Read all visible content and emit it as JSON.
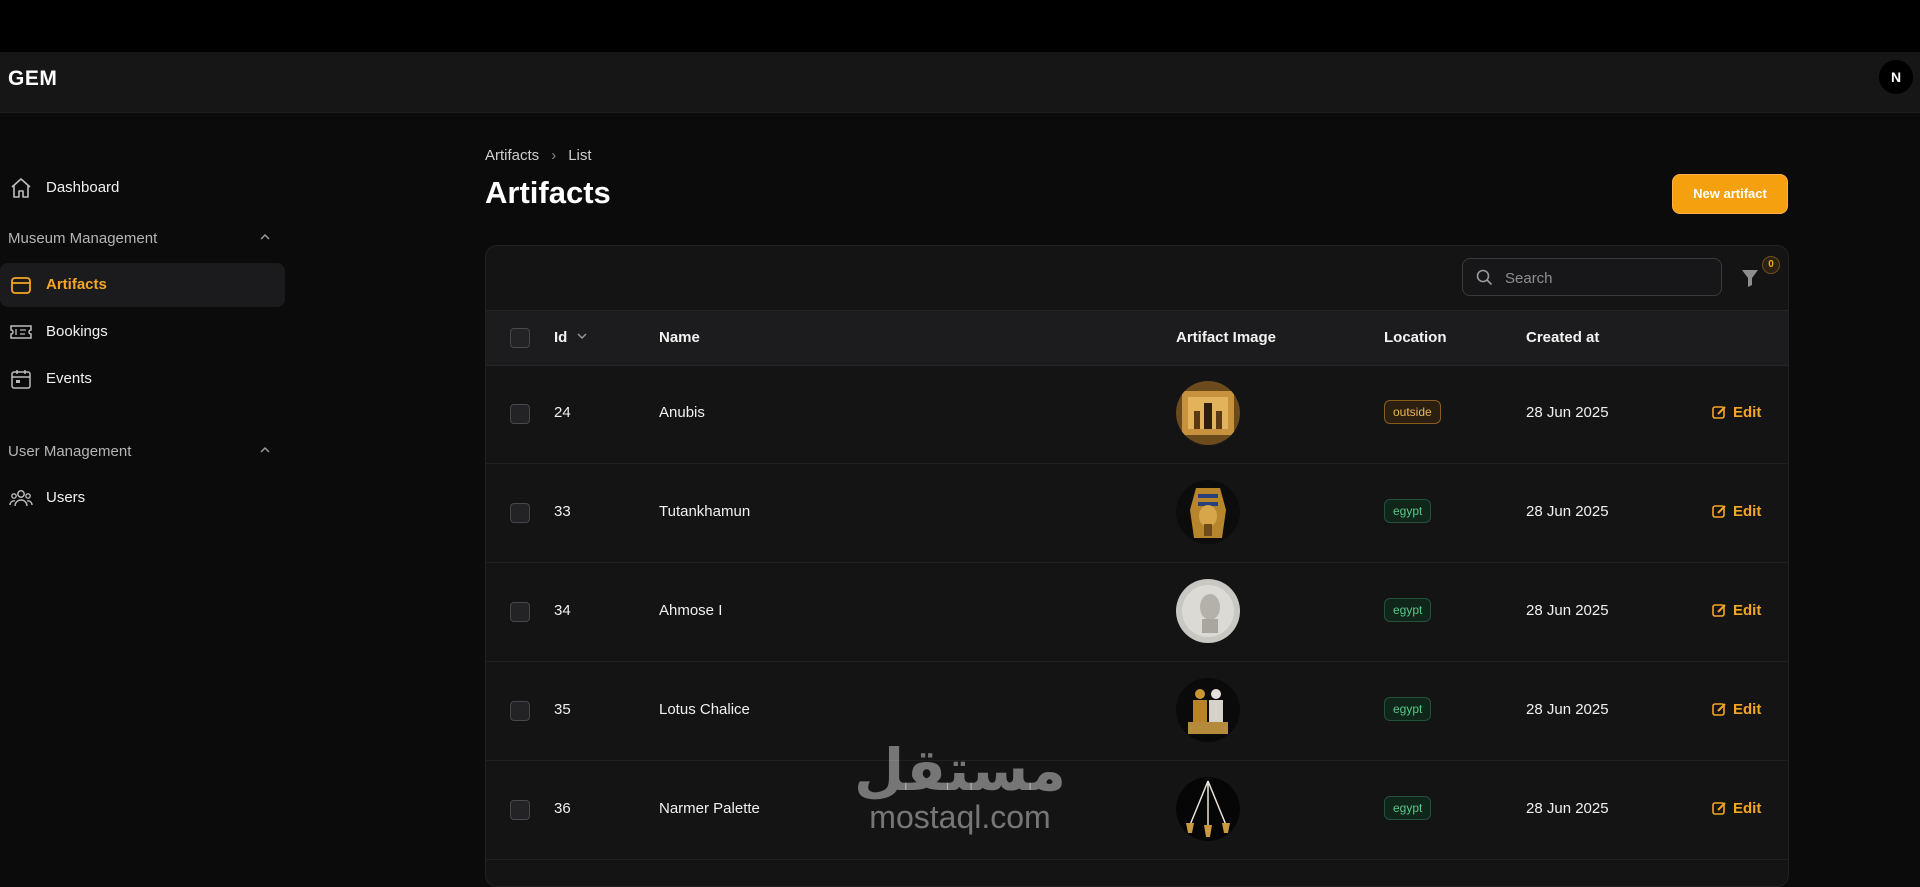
{
  "header": {
    "brand": "GEM",
    "avatar_initial": "N"
  },
  "sidebar": {
    "dashboard": "Dashboard",
    "groups": [
      {
        "label": "Museum Management",
        "items": [
          "Artifacts",
          "Bookings",
          "Events"
        ]
      },
      {
        "label": "User Management",
        "items": [
          "Users"
        ]
      }
    ],
    "active_item": "Artifacts"
  },
  "breadcrumb": {
    "parent": "Artifacts",
    "current": "List"
  },
  "page": {
    "title": "Artifacts",
    "new_button": "New artifact"
  },
  "table": {
    "search_placeholder": "Search",
    "filter_count": "0",
    "columns": [
      "Id",
      "Name",
      "Artifact Image",
      "Location",
      "Created at"
    ],
    "edit_label": "Edit",
    "rows": [
      {
        "id": "24",
        "name": "Anubis",
        "location": "outside",
        "created_at": "28 Jun 2025"
      },
      {
        "id": "33",
        "name": "Tutankhamun",
        "location": "egypt",
        "created_at": "28 Jun 2025"
      },
      {
        "id": "34",
        "name": "Ahmose I",
        "location": "egypt",
        "created_at": "28 Jun 2025"
      },
      {
        "id": "35",
        "name": "Lotus Chalice",
        "location": "egypt",
        "created_at": "28 Jun 2025"
      },
      {
        "id": "36",
        "name": "Narmer Palette",
        "location": "egypt",
        "created_at": "28 Jun 2025"
      }
    ]
  },
  "watermark": {
    "arabic": "مستقل",
    "latin": "mostaql.com"
  },
  "colors": {
    "accent": "#f5a623",
    "outside": "#f0b55b",
    "egypt": "#57c98a"
  }
}
